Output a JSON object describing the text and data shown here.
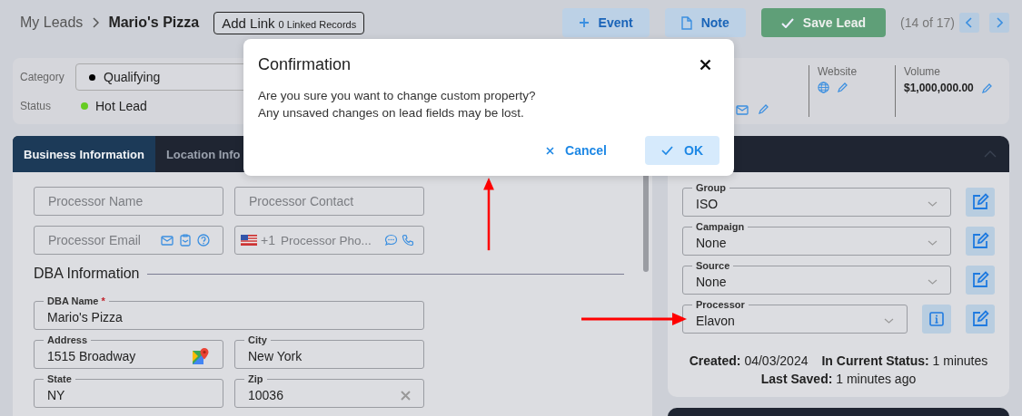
{
  "breadcrumb": {
    "parent": "My Leads",
    "current": "Mario's Pizza"
  },
  "add_link": {
    "label": "Add Link",
    "count": "0 Linked Records"
  },
  "actions": [
    {
      "kind": "event",
      "label": "Event"
    },
    {
      "kind": "note",
      "label": "Note"
    },
    {
      "kind": "save",
      "label": "Save Lead"
    }
  ],
  "pager": {
    "position": "(14 of 17)"
  },
  "summary": {
    "category": {
      "label": "Category",
      "value": "Qualifying"
    },
    "status": {
      "label": "Status",
      "value": "Hot Lead",
      "color": "#66cc22"
    },
    "website": {
      "label": "Website"
    },
    "volume": {
      "label": "Volume",
      "value": "$1,000,000.00"
    }
  },
  "tabs": [
    {
      "label": "Business Information",
      "selected": true
    },
    {
      "label": "Location Info",
      "selected": false
    }
  ],
  "processor_fields": [
    {
      "kind": "text",
      "placeholder": "Processor Name"
    },
    {
      "kind": "text",
      "placeholder": "Processor Contact"
    },
    {
      "kind": "email",
      "placeholder": "Processor Email"
    },
    {
      "kind": "phone",
      "prefix": "+1",
      "placeholder": "Processor Pho..."
    }
  ],
  "dba": {
    "heading": "DBA Information",
    "fields": [
      {
        "kind": "wide",
        "label": "DBA Name",
        "required_mark": "*",
        "value": "Mario's Pizza"
      },
      {
        "kind": "address",
        "label": "Address",
        "value": "1515 Broadway"
      },
      {
        "kind": "plain",
        "label": "City",
        "value": "New York"
      },
      {
        "kind": "plain",
        "label": "State",
        "value": "NY"
      },
      {
        "kind": "clearable",
        "label": "Zip",
        "value": "10036"
      }
    ]
  },
  "side": {
    "fields": [
      {
        "label": "Group",
        "value": "ISO",
        "info": false
      },
      {
        "label": "Campaign",
        "value": "None",
        "info": false
      },
      {
        "label": "Source",
        "value": "None",
        "info": false
      },
      {
        "label": "Processor",
        "value": "Elavon",
        "info": true
      }
    ],
    "footer": [
      [
        "**Created:** 04/03/2024",
        "**In Current Status:** 1 minutes"
      ],
      [
        "**Last Saved:** 1 minutes ago"
      ]
    ]
  },
  "dialog": {
    "title": "Confirmation",
    "message": [
      "Are you sure you want to change custom property?",
      "Any unsaved changes on lead fields may be lost."
    ],
    "buttons": [
      {
        "kind": "cancel",
        "label": "Cancel"
      },
      {
        "kind": "ok",
        "label": "OK"
      }
    ]
  }
}
